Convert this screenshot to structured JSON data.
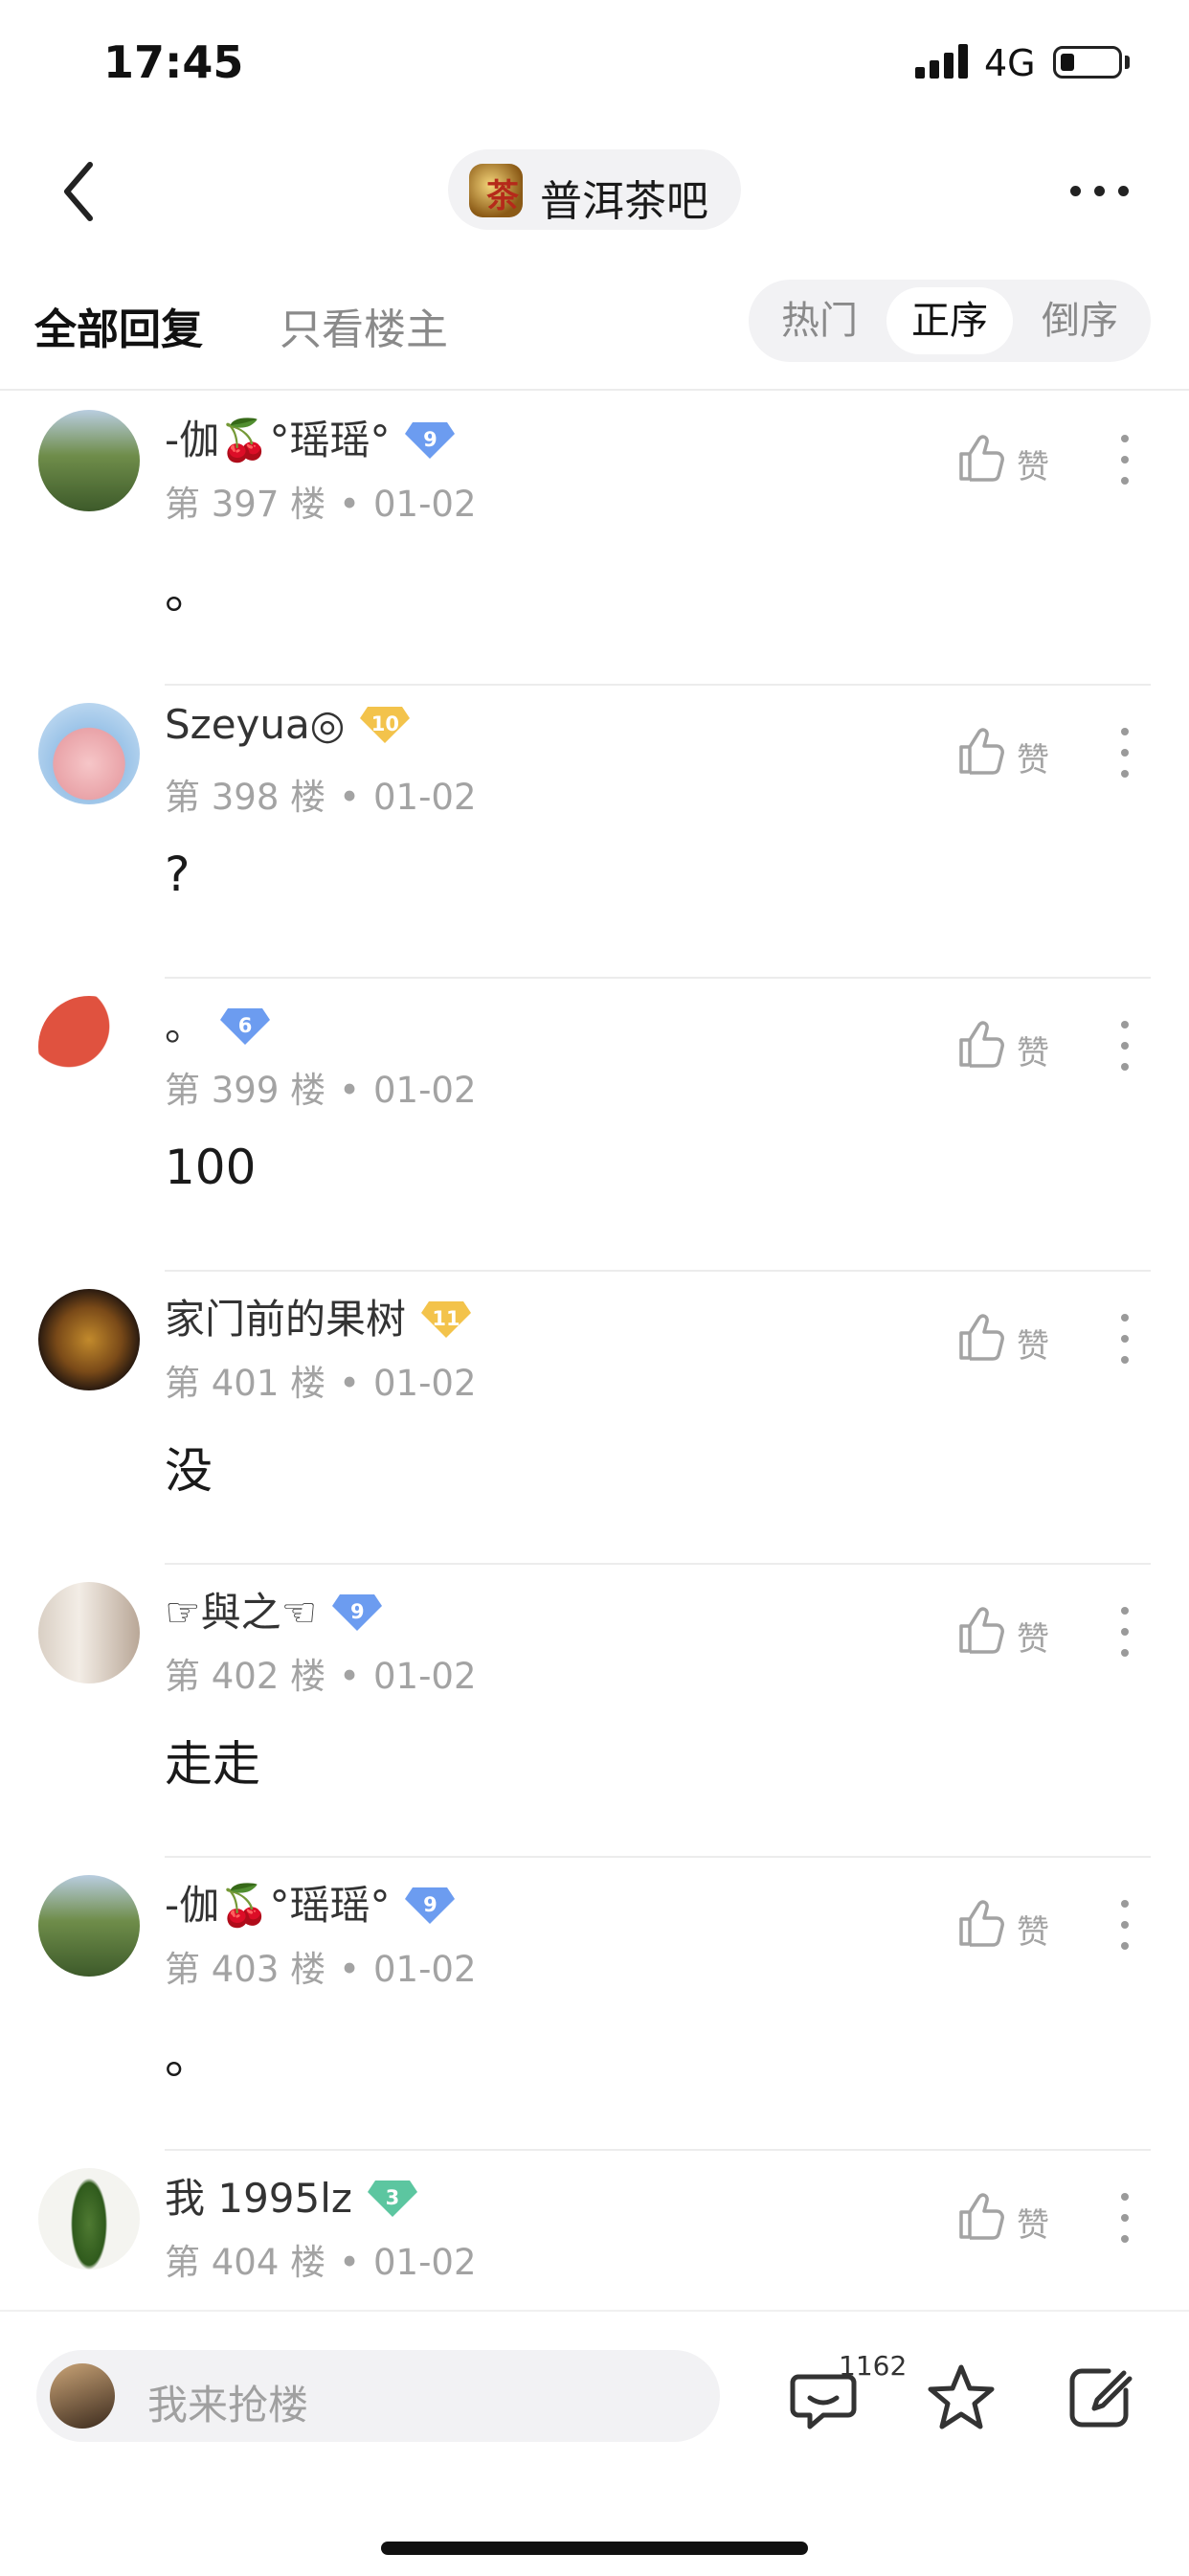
{
  "status": {
    "time": "17:45",
    "network": "4G"
  },
  "nav": {
    "forum_name": "普洱茶吧",
    "forum_logo_char": "茶"
  },
  "tabs": {
    "all_replies": "全部回复",
    "host_only": "只看楼主"
  },
  "sort": {
    "hot": "热门",
    "asc": "正序",
    "desc": "倒序",
    "active": "正序"
  },
  "posts": [
    {
      "username": "-伽🍒°瑶瑶°",
      "level": "9",
      "floor": "第 397 楼",
      "date": "01-02",
      "content": "。",
      "like_label": "赞"
    },
    {
      "username": "Szeyua◎",
      "level": "10",
      "floor": "第 398 楼",
      "date": "01-02",
      "content": "?",
      "like_label": "赞"
    },
    {
      "username": "。",
      "level": "6",
      "floor": "第 399 楼",
      "date": "01-02",
      "content": "100",
      "like_label": "赞"
    },
    {
      "username": "家门前的果树",
      "level": "11",
      "floor": "第 401 楼",
      "date": "01-02",
      "content": "没",
      "like_label": "赞"
    },
    {
      "username": "☞與之☜",
      "level": "9",
      "floor": "第 402 楼",
      "date": "01-02",
      "content": "走走",
      "like_label": "赞"
    },
    {
      "username": "-伽🍒°瑶瑶°",
      "level": "9",
      "floor": "第 403 楼",
      "date": "01-02",
      "content": "。",
      "like_label": "赞"
    },
    {
      "username": "我 1995lz",
      "level": "3",
      "floor": "第 404 楼",
      "date": "01-02",
      "content": "",
      "like_label": "赞"
    }
  ],
  "bottom": {
    "reply_placeholder": "我来抢楼",
    "comment_count": "1162"
  },
  "colors": {
    "level_blue": "#6c9cf0",
    "level_gold": "#f3c34b",
    "level_green": "#5cc6a0",
    "text_muted": "#a3a3a3"
  }
}
